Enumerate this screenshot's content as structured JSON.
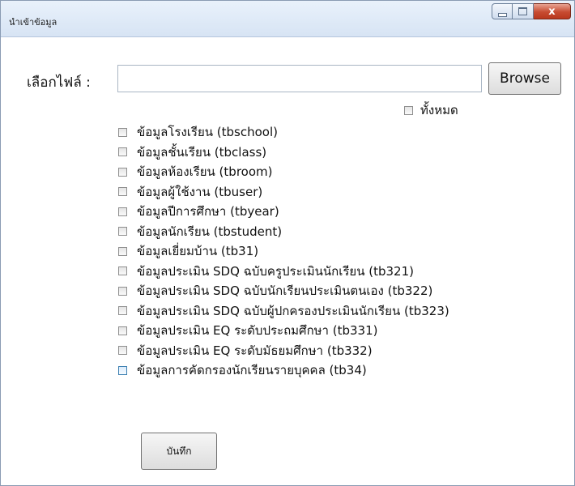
{
  "window": {
    "title": "นำเข้าข้อมูล",
    "close_glyph": "x"
  },
  "file": {
    "label": "เลือกไฟล์ :",
    "value": "",
    "placeholder": "",
    "browse_label": "Browse"
  },
  "select_all": {
    "label": "ทั้งหมด",
    "checked": false
  },
  "options": [
    {
      "label": "ข้อมูลโรงเรียน (tbschool)",
      "checked": false
    },
    {
      "label": "ข้อมูลชั้นเรียน (tbclass)",
      "checked": false
    },
    {
      "label": "ข้อมูลห้องเรียน (tbroom)",
      "checked": false
    },
    {
      "label": "ข้อมูลผู้ใช้งาน (tbuser)",
      "checked": false
    },
    {
      "label": "ข้อมูลปีการศึกษา (tbyear)",
      "checked": false
    },
    {
      "label": "ข้อมูลนักเรียน (tbstudent)",
      "checked": false
    },
    {
      "label": "ข้อมูลเยี่ยมบ้าน (tb31)",
      "checked": false
    },
    {
      "label": "ข้อมูลประเมิน SDQ ฉบับครูประเมินนักเรียน (tb321)",
      "checked": false
    },
    {
      "label": "ข้อมูลประเมิน SDQ ฉบับนักเรียนประเมินตนเอง (tb322)",
      "checked": false
    },
    {
      "label": "ข้อมูลประเมิน SDQ ฉบับผู้ปกครองประเมินนักเรียน (tb323)",
      "checked": false
    },
    {
      "label": "ข้อมูลประเมิน EQ ระดับประถมศึกษา (tb331)",
      "checked": false
    },
    {
      "label": "ข้อมูลประเมิน EQ ระดับมัธยมศึกษา (tb332)",
      "checked": false
    },
    {
      "label": "ข้อมูลการคัดกรองนักเรียนรายบุคคล (tb34)",
      "checked": false
    }
  ],
  "save_label": "บันทึก"
}
